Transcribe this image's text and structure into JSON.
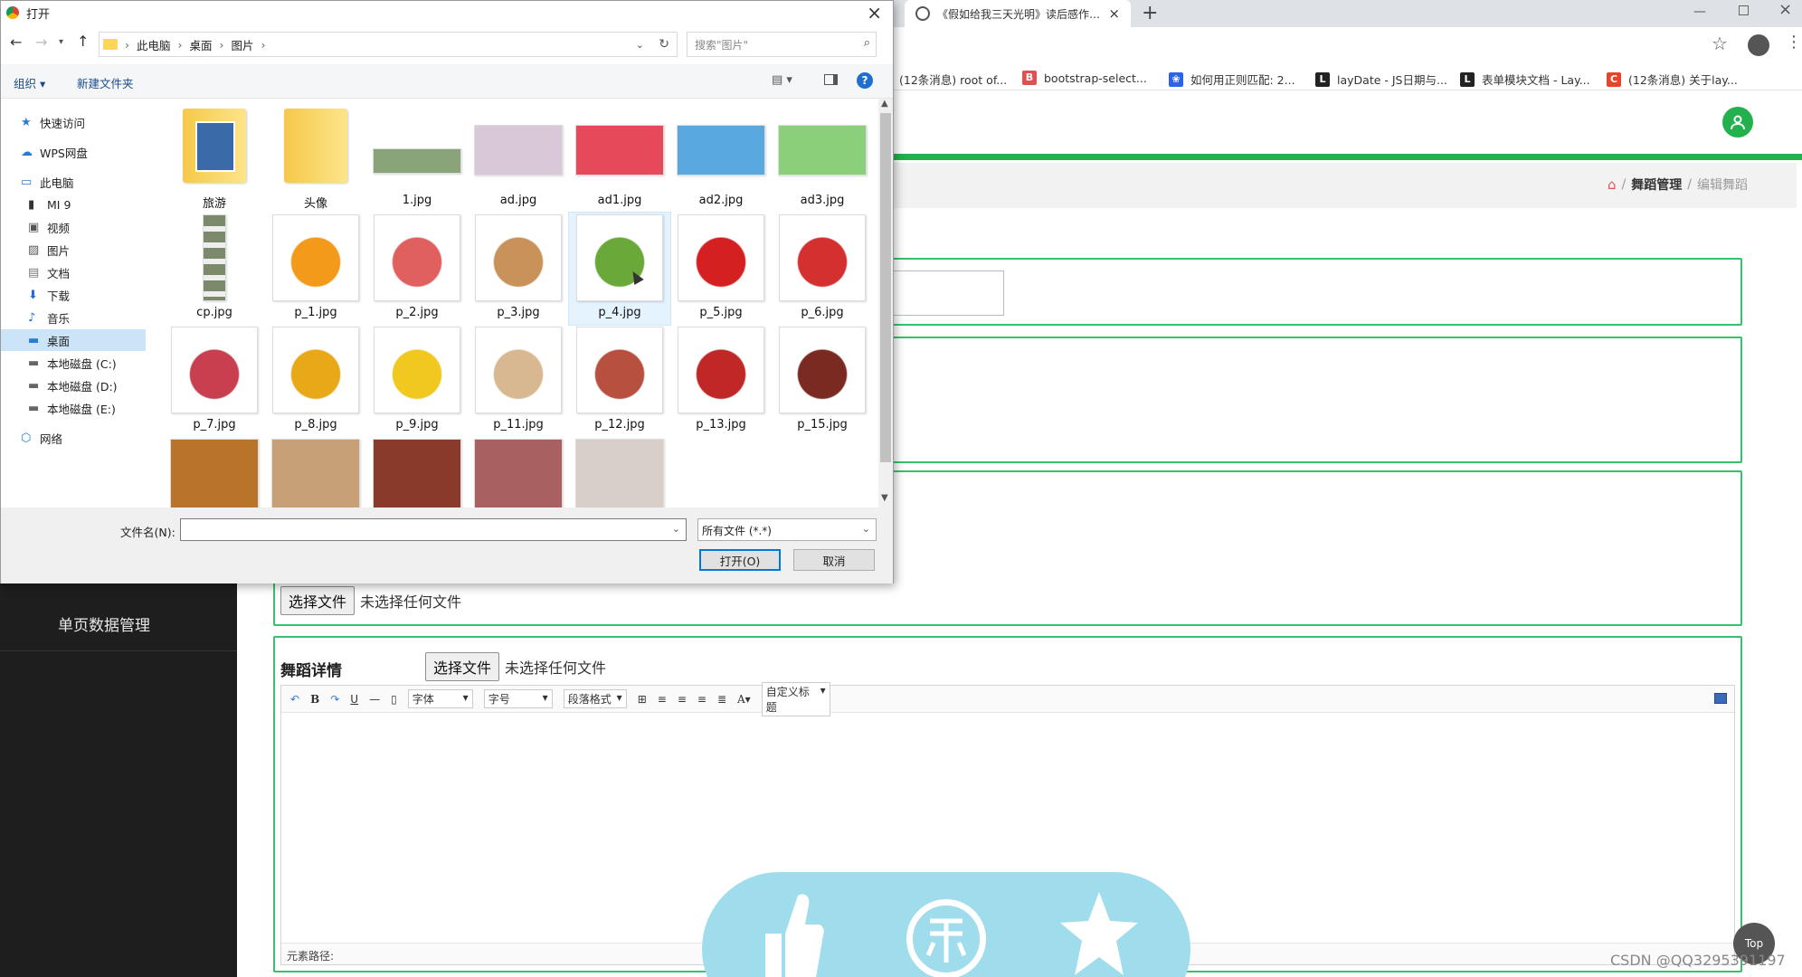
{
  "browser": {
    "tab_title": "《假如给我三天光明》读后感作…",
    "new_tab": "+",
    "bookmarks": [
      {
        "label": "(12条消息) root of...",
        "icon": "csdn-icon"
      },
      {
        "label": "bootstrap-select...",
        "icon": "site-icon"
      },
      {
        "label": "如何用正则匹配: 2...",
        "icon": "baidu-icon"
      },
      {
        "label": "layDate - JS日期与...",
        "icon": "layui-icon"
      },
      {
        "label": "表单模块文档 - Lay...",
        "icon": "layui-icon"
      },
      {
        "label": "(12条消息) 关于lay...",
        "icon": "csdn-icon"
      }
    ]
  },
  "admin": {
    "breadcrumb": {
      "sep": "/",
      "item1": "舞蹈管理",
      "item2": "编辑舞蹈"
    },
    "sidebar_item": "单页数据管理",
    "file_btn_label": "选择文件",
    "file_none": "未选择任何文件",
    "detail_label": "舞蹈详情",
    "editor": {
      "font": "字体",
      "size": "字号",
      "paragraph": "段落格式",
      "custom_title": "自定义标题",
      "path_label": "元素路径:"
    },
    "top_label": "Top",
    "watermark": "CSDN @QQ3295391197"
  },
  "dialog": {
    "title": "打开",
    "breadcrumb": [
      "此电脑",
      "桌面",
      "图片"
    ],
    "search_placeholder": "搜索\"图片\"",
    "organize": "组织 ▾",
    "new_folder": "新建文件夹",
    "nav": [
      {
        "label": "快速访问",
        "icon": "star-icon",
        "indent": 1
      },
      {
        "label": "WPS网盘",
        "icon": "cloud-icon",
        "indent": 1
      },
      {
        "label": "此电脑",
        "icon": "computer-icon",
        "indent": 1
      },
      {
        "label": "MI 9",
        "icon": "phone-icon",
        "indent": 2
      },
      {
        "label": "视频",
        "icon": "video-icon",
        "indent": 2
      },
      {
        "label": "图片",
        "icon": "picture-icon",
        "indent": 2
      },
      {
        "label": "文档",
        "icon": "document-icon",
        "indent": 2
      },
      {
        "label": "下载",
        "icon": "download-icon",
        "indent": 2
      },
      {
        "label": "音乐",
        "icon": "music-icon",
        "indent": 2
      },
      {
        "label": "桌面",
        "icon": "desktop-icon",
        "indent": 2,
        "selected": true
      },
      {
        "label": "本地磁盘 (C:)",
        "icon": "disk-icon",
        "indent": 2
      },
      {
        "label": "本地磁盘 (D:)",
        "icon": "disk-icon",
        "indent": 2
      },
      {
        "label": "本地磁盘 (E:)",
        "icon": "disk-icon",
        "indent": 2
      },
      {
        "label": "网络",
        "icon": "network-icon",
        "indent": 1
      }
    ],
    "files": [
      {
        "name": "旅游",
        "kind": "folder-photo"
      },
      {
        "name": "头像",
        "kind": "folder"
      },
      {
        "name": "1.jpg",
        "kind": "banner",
        "color": "#8aa47a"
      },
      {
        "name": "ad.jpg",
        "kind": "banner",
        "color": "#d8c8d8"
      },
      {
        "name": "ad1.jpg",
        "kind": "banner",
        "color": "#e64a5a"
      },
      {
        "name": "ad2.jpg",
        "kind": "banner",
        "color": "#5aa8e0"
      },
      {
        "name": "ad3.jpg",
        "kind": "banner",
        "color": "#8ccf7a"
      },
      {
        "name": "cp.jpg",
        "kind": "tall",
        "color": "#7a8a6a"
      },
      {
        "name": "p_1.jpg",
        "kind": "square",
        "color": "#f39a1a"
      },
      {
        "name": "p_2.jpg",
        "kind": "square",
        "color": "#e06060"
      },
      {
        "name": "p_3.jpg",
        "kind": "square",
        "color": "#c8925a"
      },
      {
        "name": "p_4.jpg",
        "kind": "square",
        "color": "#6aa83a",
        "selected": true
      },
      {
        "name": "p_5.jpg",
        "kind": "square",
        "color": "#d42020"
      },
      {
        "name": "p_6.jpg",
        "kind": "square",
        "color": "#d43030"
      },
      {
        "name": "p_7.jpg",
        "kind": "square",
        "color": "#c84050"
      },
      {
        "name": "p_8.jpg",
        "kind": "square",
        "color": "#e8a818"
      },
      {
        "name": "p_9.jpg",
        "kind": "square",
        "color": "#f0c820"
      },
      {
        "name": "p_11.jpg",
        "kind": "square",
        "color": "#d8b890"
      },
      {
        "name": "p_12.jpg",
        "kind": "square",
        "color": "#b85040"
      },
      {
        "name": "p_13.jpg",
        "kind": "square",
        "color": "#c02828"
      },
      {
        "name": "p_15.jpg",
        "kind": "square",
        "color": "#7a2a20"
      },
      {
        "name": "",
        "kind": "partial",
        "color": "#b8742a"
      },
      {
        "name": "",
        "kind": "partial",
        "color": "#c8a078"
      },
      {
        "name": "",
        "kind": "partial",
        "color": "#8a3a2a"
      },
      {
        "name": "",
        "kind": "partial",
        "color": "#a86060"
      },
      {
        "name": "",
        "kind": "partial",
        "color": "#d8d0c8"
      }
    ],
    "filename_label": "文件名(N):",
    "filename_value": "",
    "filetype": "所有文件 (*.*)",
    "open_button": "打开(O)",
    "cancel_button": "取消"
  },
  "colors": {
    "accent_green": "#22b14c",
    "box_green": "#34c26f",
    "cyan_float": "#9fdcec"
  }
}
